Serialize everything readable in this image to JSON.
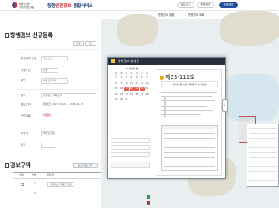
{
  "header": {
    "org_logo_text": "해양수산부\n국립해양조사원",
    "service_prefix": "항행",
    "service_highlight": "안전정보",
    "service_suffix": " 통합서비스",
    "tabs": [
      {
        "label": "해도검색"
      },
      {
        "label": "항행정보"
      },
      {
        "label": "항행경보"
      }
    ],
    "subnav": [
      "항행경보 발행",
      "항행경보 조회"
    ]
  },
  "form": {
    "title": "항행경보 신규등록",
    "top_buttons": [
      "저장",
      "취소"
    ],
    "rows": [
      {
        "label": "항행경보 구분",
        "value": "해상소식"
      },
      {
        "label": "관할기관",
        "value": "인천"
      },
      {
        "label": "해역",
        "value": "해양안전지역"
      },
      {
        "label": "제목",
        "value": "항행경보 제목 입력"
      },
      {
        "label": "경보기간",
        "value": "해양조업 2023-01-20 ~ 2023-02-15"
      },
      {
        "label": "관련자료",
        "value": "파일첨부"
      },
      {
        "label": "작성자",
        "value": "해양조사원"
      },
      {
        "label": "비고",
        "value": ""
      }
    ]
  },
  "section": {
    "title": "경보구역",
    "add_button": "경도/위도 입력",
    "columns": [
      "선택",
      "번호",
      "좌표값"
    ],
    "rows": [
      {
        "no": "1",
        "coord": "위도·경도 좌표값 입력",
        "extra": ""
      },
      {
        "no": "2",
        "coord": "",
        "extra": ""
      }
    ]
  },
  "popup": {
    "title": "항행경보 상세본",
    "calendar_month": "2023년 1월",
    "weekdays": [
      "일",
      "월",
      "화",
      "수",
      "목",
      "금",
      "토"
    ],
    "selected_days": [
      "17",
      "18",
      "19",
      "20"
    ],
    "doc_number": "제23-111호",
    "doc_subject": "[동해] 동 해상 기뢰탐색 실시 알림",
    "handle_glyph": "⋮"
  },
  "colors": {
    "brand_navy": "#1f3d6e",
    "accent_red": "#c6282f",
    "active_tab": "#1f4e9b",
    "popup_header": "#24303c",
    "calendar_selected": "#e25b4b"
  }
}
